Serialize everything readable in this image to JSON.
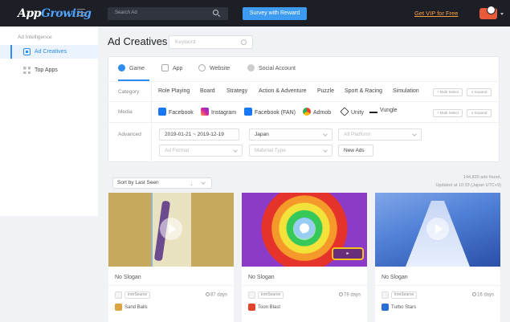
{
  "topbar": {
    "logo_prefix": "App",
    "logo_accent": "Growing",
    "search_placeholder": "Search Ad",
    "survey_label": "Survey with Reward",
    "vip_label": "Get VIP for Free"
  },
  "sidebar": {
    "heading": "Ad Intelligence",
    "items": [
      {
        "label": "Ad Creatives",
        "active": true,
        "icon": "ad-creatives-icon"
      },
      {
        "label": "Top Apps",
        "active": false,
        "icon": "grid-icon"
      }
    ]
  },
  "main": {
    "title": "Ad Creatives",
    "keyword_placeholder": "Keyword",
    "tabs": [
      {
        "label": "Game",
        "active": true,
        "icon": "gamepad-icon"
      },
      {
        "label": "App",
        "active": false,
        "icon": "app-icon"
      },
      {
        "label": "Website",
        "active": false,
        "icon": "globe-icon"
      },
      {
        "label": "Social Account",
        "active": false,
        "icon": "chat-icon"
      }
    ],
    "category": {
      "label": "Category",
      "options": [
        "Role Playing",
        "Board",
        "Strategy",
        "Action & Adventure",
        "Puzzle",
        "Sport & Racing",
        "Simulation"
      ],
      "multi_select": "+ Multi Select",
      "expand": "∨ Expand"
    },
    "media": {
      "label": "Media",
      "options": [
        {
          "name": "Facebook",
          "color": "#1877f2"
        },
        {
          "name": "Instagram",
          "color": "#d6249f"
        },
        {
          "name": "Facebook (FAN)",
          "color": "#1877f2"
        },
        {
          "name": "Admob",
          "color": "#ea4335"
        },
        {
          "name": "Unity",
          "color": "#222222"
        },
        {
          "name": "Vungle",
          "color": "#222222"
        }
      ],
      "multi_select": "+ Multi Select",
      "expand": "∨ Expand"
    },
    "advanced": {
      "label": "Advanced",
      "date_range": "2019-01-21  ~  2019-12-19",
      "country": "Japan",
      "platform_placeholder": "All Platform",
      "format_placeholder": "Ad Format",
      "material_placeholder": "Material Type",
      "new_ads": "New Ads"
    }
  },
  "results": {
    "sort_label": "Sort by Last Seen",
    "found_text": "144,830 ads found,",
    "updated_text": "Updated at 10:33 (Japan UTC+9)",
    "cards": [
      {
        "slogan": "No Slogan",
        "network": "ironSource",
        "days": "87 days",
        "app": "Sand Balls"
      },
      {
        "slogan": "No Slogan",
        "network": "ironSource",
        "days": "78 days",
        "app": "Toon Blast"
      },
      {
        "slogan": "No Slogan",
        "network": "ironSource",
        "days": "16 days",
        "app": "Turbo Stars"
      }
    ]
  },
  "colors": {
    "accent": "#2d8cf0",
    "topbar": "#1c1f26",
    "vip": "#ff9f40"
  }
}
